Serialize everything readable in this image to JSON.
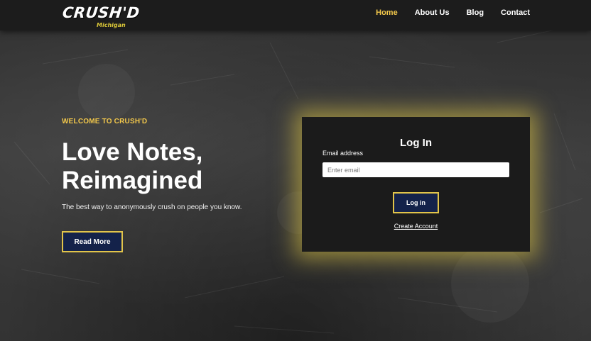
{
  "header": {
    "logo_text": "CRUSH'D",
    "logo_subtext": "Michigan",
    "nav": [
      {
        "label": "Home",
        "active": true
      },
      {
        "label": "About Us",
        "active": false
      },
      {
        "label": "Blog",
        "active": false
      },
      {
        "label": "Contact",
        "active": false
      }
    ]
  },
  "hero": {
    "eyebrow": "WELCOME TO CRUSH'D",
    "headline_line1": "Love Notes,",
    "headline_line2": "Reimagined",
    "tagline": "The best way to anonymously crush on people you know.",
    "cta_label": "Read More"
  },
  "login": {
    "title": "Log In",
    "email_label": "Email address",
    "email_placeholder": "Enter email",
    "email_value": "",
    "submit_label": "Log in",
    "create_account_label": "Create Account"
  },
  "colors": {
    "accent_yellow": "#f3c84b",
    "button_navy": "#14224a",
    "button_border": "#e1c44a",
    "card_bg": "#1b1b1b",
    "header_bg": "#1c1c1c"
  }
}
